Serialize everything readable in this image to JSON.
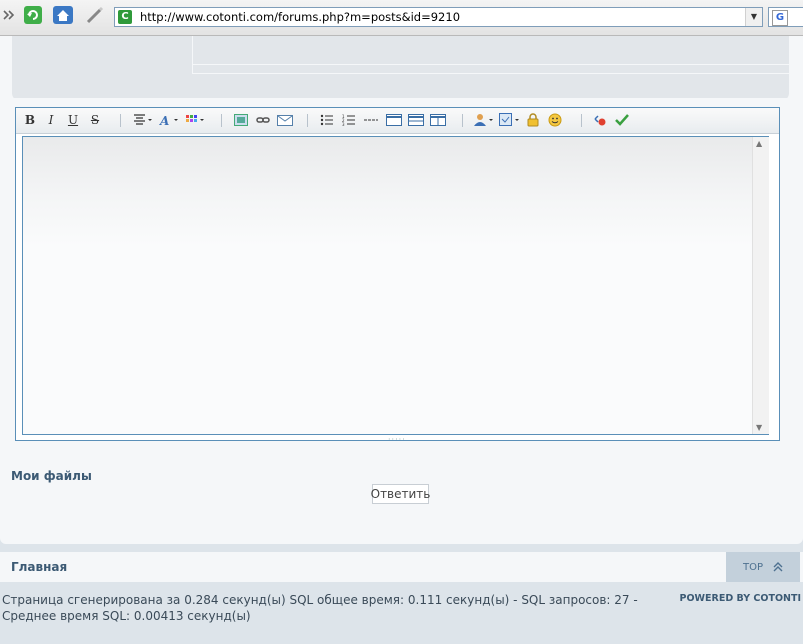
{
  "browser": {
    "url": "http://www.cotonti.com/forums.php?m=posts&id=9210",
    "favicon_letter": "C",
    "search_engine_letter": "G"
  },
  "editor": {
    "toolbar": {
      "bold": "B",
      "italic": "I",
      "underline": "U",
      "strike": "S"
    },
    "text": ""
  },
  "my_files_label": "Мои файлы",
  "reply_button": "Ответить",
  "navbar": {
    "home": "Главная",
    "top": "TOP"
  },
  "footer": {
    "stats": "Страница сгенерирована за 0.284 секунд(ы) SQL общее время: 0.111 секунд(ы) - SQL запросов: 27 - Среднее время SQL: 0.00413 секунд(ы)",
    "powered": "POWERED BY COTONTI"
  }
}
